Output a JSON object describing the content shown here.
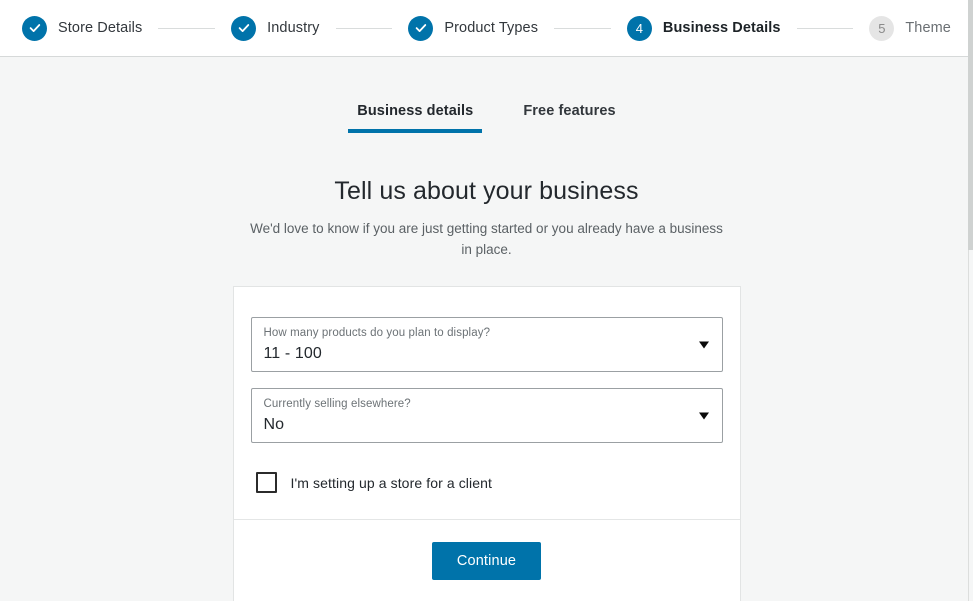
{
  "stepper": {
    "steps": [
      {
        "label": "Store Details",
        "state": "done",
        "marker": "check"
      },
      {
        "label": "Industry",
        "state": "done",
        "marker": "check"
      },
      {
        "label": "Product Types",
        "state": "done",
        "marker": "check"
      },
      {
        "label": "Business Details",
        "state": "current",
        "marker": "4"
      },
      {
        "label": "Theme",
        "state": "todo",
        "marker": "5"
      }
    ]
  },
  "tabs": [
    {
      "label": "Business details",
      "active": true
    },
    {
      "label": "Free features",
      "active": false
    }
  ],
  "heading": "Tell us about your business",
  "subheading": "We'd love to know if you are just getting started or you already have a business in place.",
  "form": {
    "product_count": {
      "label": "How many products do you plan to display?",
      "value": "11 - 100"
    },
    "selling_elsewhere": {
      "label": "Currently selling elsewhere?",
      "value": "No"
    },
    "client_checkbox": {
      "label": "I'm setting up a store for a client",
      "checked": false
    },
    "continue_label": "Continue"
  },
  "colors": {
    "accent": "#0073aa",
    "page_bg": "#f5f6f6",
    "card_bg": "#ffffff",
    "muted_text": "#6c7276",
    "todo_bullet": "#e5e5e5"
  }
}
